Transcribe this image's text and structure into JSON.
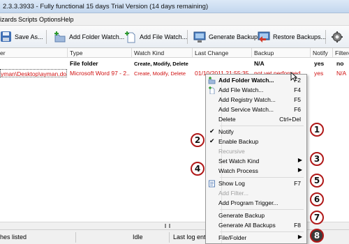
{
  "window": {
    "title": "2.3.3.3933 - Fully functional 15 days Trial Version (14 days remaining)"
  },
  "menu": [
    "izards",
    "Scripts",
    "Options",
    "Help"
  ],
  "toolbar": {
    "save_as": "Save As...",
    "add_folder_watch": "Add Folder Watch...",
    "add_file_watch": "Add File Watch...",
    "generate_backups": "Generate Backups",
    "restore_backups": "Restore Backups...",
    "icons": [
      "disk-icon",
      "folder-add-icon",
      "file-add-icon",
      "monitor-backup-icon",
      "monitor-restore-icon",
      "gear-icon"
    ]
  },
  "columns": {
    "name": "er",
    "type": "Type",
    "watch_kind": "Watch Kind",
    "last_change": "Last Change",
    "backup": "Backup",
    "notify": "Notify",
    "filters": "Filtere"
  },
  "rows": [
    {
      "name": "",
      "type": "File folder",
      "watch_kind": "Create, Modify, Delete",
      "last_change": "",
      "backup": "N/A",
      "notify": "yes",
      "filters": "no"
    },
    {
      "name": "yman\\Desktop\\ayman.doc",
      "type": "Microsoft Word 97 - 2...",
      "watch_kind": "Create, Modify, Delete",
      "last_change": "01/10/2011 21:55:35",
      "backup": "not yet performed",
      "notify": "yes",
      "filters": "N/A"
    }
  ],
  "context_menu": {
    "add_folder_watch": {
      "label": "Add Folder Watch...",
      "shortcut": "F2"
    },
    "add_file_watch": {
      "label": "Add File Watch...",
      "shortcut": "F4"
    },
    "add_registry_watch": {
      "label": "Add Registry Watch...",
      "shortcut": "F5"
    },
    "add_service_watch": {
      "label": "Add Service Watch...",
      "shortcut": "F6"
    },
    "delete": {
      "label": "Delete",
      "shortcut": "Ctrl+Del"
    },
    "notify": {
      "label": "Notify"
    },
    "enable_backup": {
      "label": "Enable Backup"
    },
    "recursive": {
      "label": "Recursive"
    },
    "set_watch_kind": {
      "label": "Set Watch Kind"
    },
    "watch_process": {
      "label": "Watch Process"
    },
    "show_log": {
      "label": "Show Log",
      "shortcut": "F7"
    },
    "add_filter": {
      "label": "Add Filter..."
    },
    "add_program_trigger": {
      "label": "Add Program Trigger..."
    },
    "generate_backup": {
      "label": "Generate Backup"
    },
    "generate_all_backups": {
      "label": "Generate All Backups",
      "shortcut": "F8"
    },
    "file_folder": {
      "label": "File/Folder"
    },
    "checked_items": [
      "Notify",
      "Enable Backup"
    ],
    "disabled_items": [
      "Recursive",
      "Add Filter..."
    ]
  },
  "badges": [
    "1",
    "2",
    "3",
    "4",
    "5",
    "6",
    "7",
    "8"
  ],
  "status": {
    "items_listed": "hes listed",
    "state": "Idle",
    "last_log": "Last log entr"
  },
  "colors": {
    "accent_red": "#d01010",
    "badge_border": "#b01818",
    "title_bar": "#c3d7ee"
  }
}
